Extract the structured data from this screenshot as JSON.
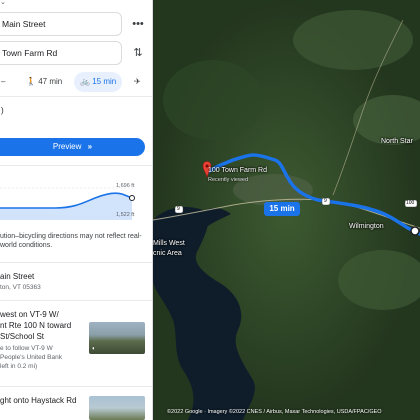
{
  "directions": {
    "origin": "Main Street",
    "destination": "Town Farm Rd",
    "travel_modes": [
      {
        "icon": "car-icon",
        "label": ""
      },
      {
        "icon": "walk-icon",
        "label": "47 min"
      },
      {
        "icon": "bike-icon",
        "label": "15 min",
        "selected": true
      },
      {
        "icon": "plane-icon",
        "label": ""
      }
    ],
    "preview_label": "Preview",
    "elevation": {
      "max": "1,696 ft",
      "min": "1,522 ft"
    },
    "warning": "ution–bicycling directions may not reflect real-world conditions.",
    "start": {
      "title": "ain Street",
      "subtitle": "ton, VT 05363"
    },
    "steps": [
      {
        "title_lines": [
          "west on VT-9 W/",
          "nt Rte 100 N toward",
          "St/School St"
        ],
        "sub_lines": [
          "e to follow VT-9 W",
          "People's United Bank",
          "left in 0.2 mi)"
        ]
      },
      {
        "title_lines": [
          "ght onto Haystack Rd"
        ],
        "sub_lines": []
      }
    ]
  },
  "map": {
    "destination_name": "100 Town Farm Rd",
    "destination_sub": "Recently viewed",
    "route_duration": "15 min",
    "labels": {
      "wilmington": "Wilmington",
      "north_star": "North Star",
      "mills_west": "Mills West",
      "picnic_area": "cnic Area"
    },
    "road_shields": {
      "route_9": "9",
      "route_100": "100"
    },
    "attribution": "©2022 Google · Imagery ©2022 CNES / Airbus, Maxar Technologies, USDA/FPAC/GEO",
    "colors": {
      "route": "#1a73e8",
      "water": "#10202e",
      "forest": "#2b4426"
    }
  }
}
